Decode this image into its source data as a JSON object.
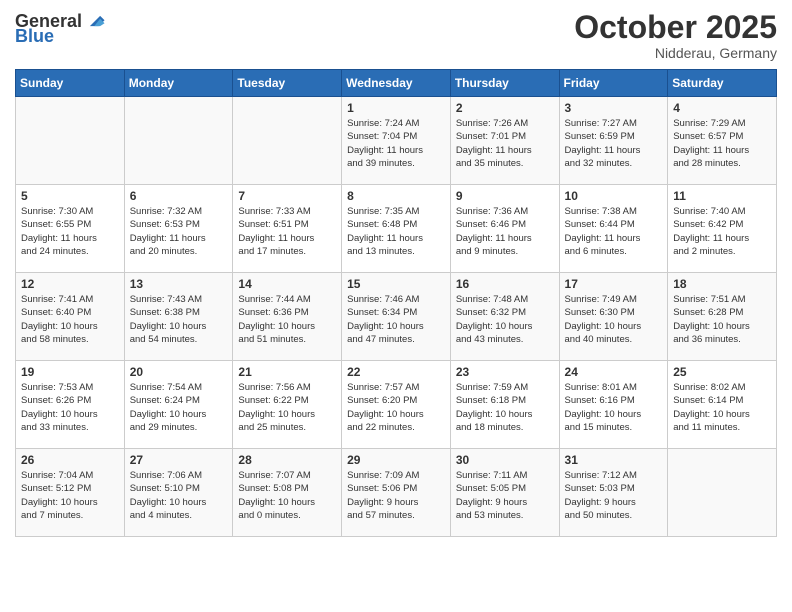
{
  "header": {
    "logo_general": "General",
    "logo_blue": "Blue",
    "month": "October 2025",
    "location": "Nidderau, Germany"
  },
  "days_of_week": [
    "Sunday",
    "Monday",
    "Tuesday",
    "Wednesday",
    "Thursday",
    "Friday",
    "Saturday"
  ],
  "weeks": [
    [
      {
        "day": "",
        "info": ""
      },
      {
        "day": "",
        "info": ""
      },
      {
        "day": "",
        "info": ""
      },
      {
        "day": "1",
        "info": "Sunrise: 7:24 AM\nSunset: 7:04 PM\nDaylight: 11 hours\nand 39 minutes."
      },
      {
        "day": "2",
        "info": "Sunrise: 7:26 AM\nSunset: 7:01 PM\nDaylight: 11 hours\nand 35 minutes."
      },
      {
        "day": "3",
        "info": "Sunrise: 7:27 AM\nSunset: 6:59 PM\nDaylight: 11 hours\nand 32 minutes."
      },
      {
        "day": "4",
        "info": "Sunrise: 7:29 AM\nSunset: 6:57 PM\nDaylight: 11 hours\nand 28 minutes."
      }
    ],
    [
      {
        "day": "5",
        "info": "Sunrise: 7:30 AM\nSunset: 6:55 PM\nDaylight: 11 hours\nand 24 minutes."
      },
      {
        "day": "6",
        "info": "Sunrise: 7:32 AM\nSunset: 6:53 PM\nDaylight: 11 hours\nand 20 minutes."
      },
      {
        "day": "7",
        "info": "Sunrise: 7:33 AM\nSunset: 6:51 PM\nDaylight: 11 hours\nand 17 minutes."
      },
      {
        "day": "8",
        "info": "Sunrise: 7:35 AM\nSunset: 6:48 PM\nDaylight: 11 hours\nand 13 minutes."
      },
      {
        "day": "9",
        "info": "Sunrise: 7:36 AM\nSunset: 6:46 PM\nDaylight: 11 hours\nand 9 minutes."
      },
      {
        "day": "10",
        "info": "Sunrise: 7:38 AM\nSunset: 6:44 PM\nDaylight: 11 hours\nand 6 minutes."
      },
      {
        "day": "11",
        "info": "Sunrise: 7:40 AM\nSunset: 6:42 PM\nDaylight: 11 hours\nand 2 minutes."
      }
    ],
    [
      {
        "day": "12",
        "info": "Sunrise: 7:41 AM\nSunset: 6:40 PM\nDaylight: 10 hours\nand 58 minutes."
      },
      {
        "day": "13",
        "info": "Sunrise: 7:43 AM\nSunset: 6:38 PM\nDaylight: 10 hours\nand 54 minutes."
      },
      {
        "day": "14",
        "info": "Sunrise: 7:44 AM\nSunset: 6:36 PM\nDaylight: 10 hours\nand 51 minutes."
      },
      {
        "day": "15",
        "info": "Sunrise: 7:46 AM\nSunset: 6:34 PM\nDaylight: 10 hours\nand 47 minutes."
      },
      {
        "day": "16",
        "info": "Sunrise: 7:48 AM\nSunset: 6:32 PM\nDaylight: 10 hours\nand 43 minutes."
      },
      {
        "day": "17",
        "info": "Sunrise: 7:49 AM\nSunset: 6:30 PM\nDaylight: 10 hours\nand 40 minutes."
      },
      {
        "day": "18",
        "info": "Sunrise: 7:51 AM\nSunset: 6:28 PM\nDaylight: 10 hours\nand 36 minutes."
      }
    ],
    [
      {
        "day": "19",
        "info": "Sunrise: 7:53 AM\nSunset: 6:26 PM\nDaylight: 10 hours\nand 33 minutes."
      },
      {
        "day": "20",
        "info": "Sunrise: 7:54 AM\nSunset: 6:24 PM\nDaylight: 10 hours\nand 29 minutes."
      },
      {
        "day": "21",
        "info": "Sunrise: 7:56 AM\nSunset: 6:22 PM\nDaylight: 10 hours\nand 25 minutes."
      },
      {
        "day": "22",
        "info": "Sunrise: 7:57 AM\nSunset: 6:20 PM\nDaylight: 10 hours\nand 22 minutes."
      },
      {
        "day": "23",
        "info": "Sunrise: 7:59 AM\nSunset: 6:18 PM\nDaylight: 10 hours\nand 18 minutes."
      },
      {
        "day": "24",
        "info": "Sunrise: 8:01 AM\nSunset: 6:16 PM\nDaylight: 10 hours\nand 15 minutes."
      },
      {
        "day": "25",
        "info": "Sunrise: 8:02 AM\nSunset: 6:14 PM\nDaylight: 10 hours\nand 11 minutes."
      }
    ],
    [
      {
        "day": "26",
        "info": "Sunrise: 7:04 AM\nSunset: 5:12 PM\nDaylight: 10 hours\nand 7 minutes."
      },
      {
        "day": "27",
        "info": "Sunrise: 7:06 AM\nSunset: 5:10 PM\nDaylight: 10 hours\nand 4 minutes."
      },
      {
        "day": "28",
        "info": "Sunrise: 7:07 AM\nSunset: 5:08 PM\nDaylight: 10 hours\nand 0 minutes."
      },
      {
        "day": "29",
        "info": "Sunrise: 7:09 AM\nSunset: 5:06 PM\nDaylight: 9 hours\nand 57 minutes."
      },
      {
        "day": "30",
        "info": "Sunrise: 7:11 AM\nSunset: 5:05 PM\nDaylight: 9 hours\nand 53 minutes."
      },
      {
        "day": "31",
        "info": "Sunrise: 7:12 AM\nSunset: 5:03 PM\nDaylight: 9 hours\nand 50 minutes."
      },
      {
        "day": "",
        "info": ""
      }
    ]
  ]
}
